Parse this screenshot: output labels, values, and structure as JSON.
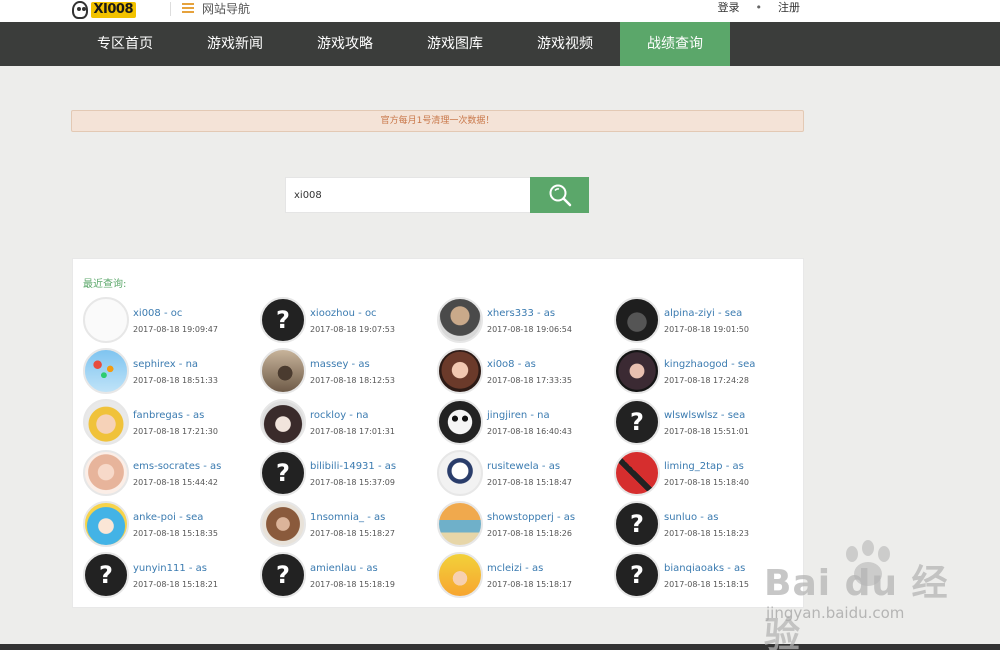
{
  "header": {
    "logo_text": "XI008",
    "site_nav_label": "网站导航",
    "login_label": "登录",
    "separator": "•",
    "register_label": "注册"
  },
  "nav": {
    "items": [
      {
        "label": "专区首页",
        "active": false
      },
      {
        "label": "游戏新闻",
        "active": false
      },
      {
        "label": "游戏攻略",
        "active": false
      },
      {
        "label": "游戏图库",
        "active": false
      },
      {
        "label": "游戏视频",
        "active": false
      },
      {
        "label": "战绩查询",
        "active": true
      }
    ]
  },
  "notice": {
    "text": "官方每月1号清理一次数据！"
  },
  "search": {
    "value": "xi008"
  },
  "recent": {
    "title": "最近查询:",
    "entries": [
      {
        "name": "xi008 - oc",
        "time": "2017-08-18 19:09:47",
        "avatar": "blank"
      },
      {
        "name": "xioozhou - oc",
        "time": "2017-08-18 19:07:53",
        "avatar": "question"
      },
      {
        "name": "xhers333 - as",
        "time": "2017-08-18 19:06:54",
        "avatar": "photo-man"
      },
      {
        "name": "alpina-ziyi - sea",
        "time": "2017-08-18 19:01:50",
        "avatar": "photo-dark"
      },
      {
        "name": "sephirex - na",
        "time": "2017-08-18 18:51:33",
        "avatar": "photo-balloons"
      },
      {
        "name": "massey - as",
        "time": "2017-08-18 18:12:53",
        "avatar": "photo-room"
      },
      {
        "name": "xi0o8 - as",
        "time": "2017-08-18 17:33:35",
        "avatar": "photo-girl"
      },
      {
        "name": "kingzhaogod - sea",
        "time": "2017-08-18 17:24:28",
        "avatar": "photo-girl2"
      },
      {
        "name": "fanbregas - as",
        "time": "2017-08-18 17:21:30",
        "avatar": "photo-baby"
      },
      {
        "name": "rockloy - na",
        "time": "2017-08-18 17:01:31",
        "avatar": "photo-anime"
      },
      {
        "name": "jingjiren - na",
        "time": "2017-08-18 16:40:43",
        "avatar": "photo-panda"
      },
      {
        "name": "wlswlswlsz - sea",
        "time": "2017-08-18 15:51:01",
        "avatar": "question"
      },
      {
        "name": "ems-socrates - as",
        "time": "2017-08-18 15:44:42",
        "avatar": "photo-woman"
      },
      {
        "name": "bilibili-14931 - as",
        "time": "2017-08-18 15:37:09",
        "avatar": "question"
      },
      {
        "name": "rusitewela - as",
        "time": "2017-08-18 15:18:47",
        "avatar": "photo-sketch"
      },
      {
        "name": "liming_2tap - as",
        "time": "2017-08-18 15:18:40",
        "avatar": "photo-red"
      },
      {
        "name": "anke-poi - sea",
        "time": "2017-08-18 15:18:35",
        "avatar": "photo-blue"
      },
      {
        "name": "1nsomnia_ - as",
        "time": "2017-08-18 15:18:27",
        "avatar": "photo-portrait"
      },
      {
        "name": "showstopperj - as",
        "time": "2017-08-18 15:18:26",
        "avatar": "photo-beach"
      },
      {
        "name": "sunluo - as",
        "time": "2017-08-18 15:18:23",
        "avatar": "question"
      },
      {
        "name": "yunyin111 - as",
        "time": "2017-08-18 15:18:21",
        "avatar": "question"
      },
      {
        "name": "amienlau - as",
        "time": "2017-08-18 15:18:19",
        "avatar": "question"
      },
      {
        "name": "mcleizi - as",
        "time": "2017-08-18 15:18:17",
        "avatar": "photo-goku"
      },
      {
        "name": "bianqiaoaks - as",
        "time": "2017-08-18 15:18:15",
        "avatar": "question"
      }
    ]
  },
  "watermark": {
    "text": "Bai du 经验",
    "url": "jingyan.baidu.com"
  },
  "colors": {
    "accent": "#5ba76a",
    "nav_bg": "#3b3d3b",
    "link": "#3b7bb0",
    "notice_text": "#c9784a"
  }
}
